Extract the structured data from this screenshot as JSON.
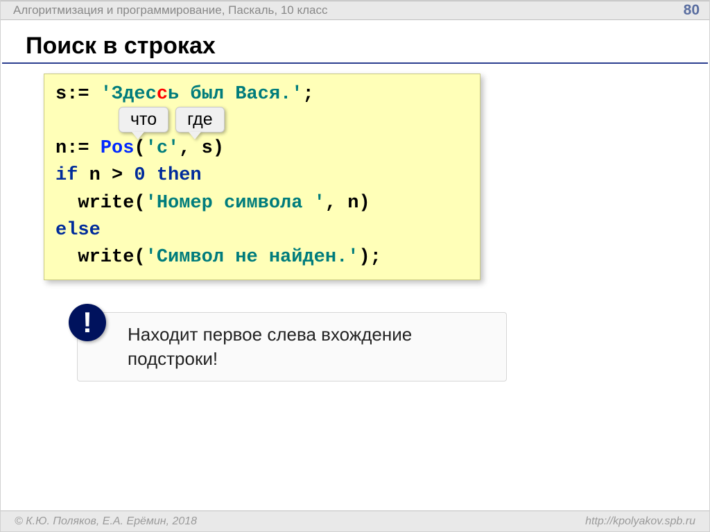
{
  "header": {
    "topic": "Алгоритмизация и программирование, Паскаль, 10 класс",
    "page_number": "80"
  },
  "title": "Поиск в строках",
  "code": {
    "l1_a": "s:= ",
    "l1_b": "'Здес",
    "l1_c": "ь был Вася.'",
    "l1_d": ";",
    "l2_a": "n:= ",
    "l2_b": "Pos",
    "l2_c": "(",
    "l2_d": "'с'",
    "l2_e": ", s)",
    "l3_a": "if",
    "l3_b": " n > ",
    "l3_c": "0",
    "l3_d": " ",
    "l3_e": "then",
    "l4_a": "  write(",
    "l4_b": "'Номер символа '",
    "l4_c": ", n)",
    "l5_a": "else",
    "l6_a": "  write(",
    "l6_b": "'Символ не найден.'",
    "l6_c": ");"
  },
  "bubbles": {
    "what": "что",
    "where": "где"
  },
  "note": {
    "badge": "!",
    "text": "Находит первое слева вхождение подстроки!"
  },
  "footer": {
    "copyright": "© К.Ю. Поляков, Е.А. Ерёмин, 2018",
    "url": "http://kpolyakov.spb.ru"
  }
}
